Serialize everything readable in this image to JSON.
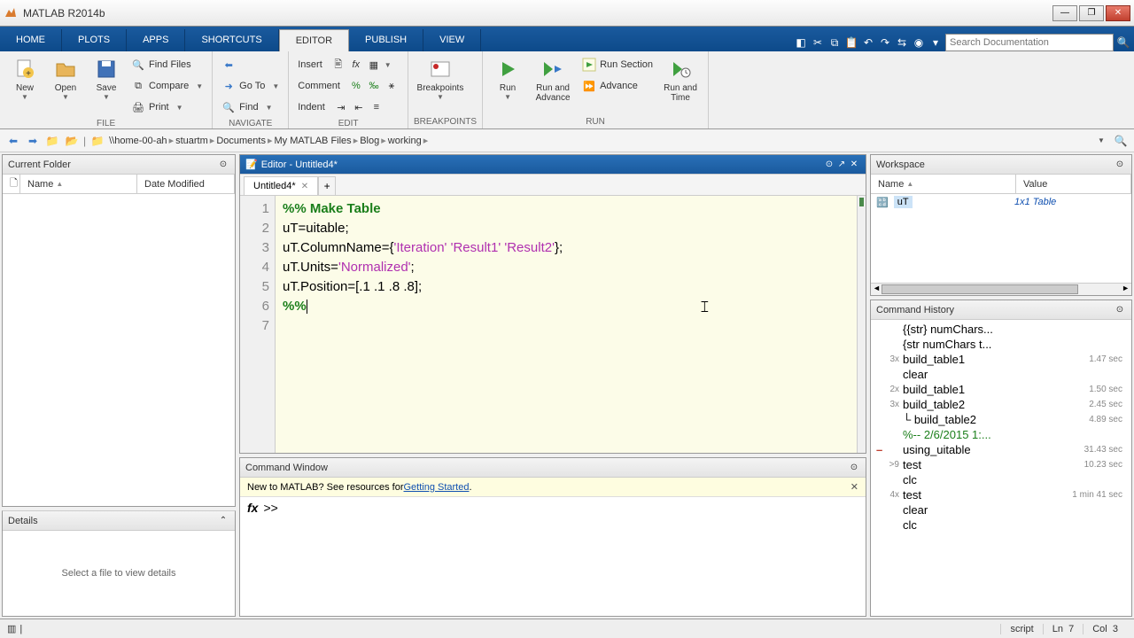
{
  "window": {
    "title": "MATLAB R2014b"
  },
  "tabs": [
    "HOME",
    "PLOTS",
    "APPS",
    "SHORTCUTS",
    "EDITOR",
    "PUBLISH",
    "VIEW"
  ],
  "activeTab": 4,
  "search": {
    "placeholder": "Search Documentation"
  },
  "toolstrip": {
    "file": {
      "new": "New",
      "open": "Open",
      "save": "Save",
      "findFiles": "Find Files",
      "compare": "Compare",
      "print": "Print",
      "label": "FILE"
    },
    "nav": {
      "goto": "Go To",
      "find": "Find",
      "label": "NAVIGATE"
    },
    "edit": {
      "insert": "Insert",
      "comment": "Comment",
      "indent": "Indent",
      "label": "EDIT"
    },
    "bp": {
      "breakpoints": "Breakpoints",
      "label": "BREAKPOINTS"
    },
    "run": {
      "run": "Run",
      "runAdvance": "Run and\nAdvance",
      "runSection": "Run Section",
      "advance": "Advance",
      "runTime": "Run and\nTime",
      "label": "RUN"
    }
  },
  "breadcrumb": [
    "\\\\home-00-ah",
    "stuartm",
    "Documents",
    "My MATLAB Files",
    "Blog",
    "working"
  ],
  "currentFolder": {
    "title": "Current Folder",
    "cols": [
      "Name",
      "Date Modified"
    ]
  },
  "details": {
    "title": "Details",
    "msg": "Select a file to view details"
  },
  "editor": {
    "title": "Editor - Untitled4*",
    "tab": "Untitled4*",
    "lines": [
      {
        "n": 1,
        "seg": [
          {
            "c": "comment",
            "t": "%% Make Table"
          }
        ]
      },
      {
        "n": 2,
        "seg": [
          {
            "c": "",
            "t": "uT=uitable;"
          }
        ]
      },
      {
        "n": 3,
        "seg": [
          {
            "c": "",
            "t": "uT.ColumnName={"
          },
          {
            "c": "string",
            "t": "'Iteration'"
          },
          {
            "c": "",
            "t": " "
          },
          {
            "c": "string",
            "t": "'Result1'"
          },
          {
            "c": "",
            "t": " "
          },
          {
            "c": "string",
            "t": "'Result2'"
          },
          {
            "c": "",
            "t": "};"
          }
        ]
      },
      {
        "n": 4,
        "seg": [
          {
            "c": "",
            "t": "uT.Units="
          },
          {
            "c": "string",
            "t": "'Normalized'"
          },
          {
            "c": "",
            "t": ";"
          }
        ]
      },
      {
        "n": 5,
        "seg": [
          {
            "c": "",
            "t": "uT.Position=[.1 .1 .8 .8];"
          }
        ]
      },
      {
        "n": 6,
        "seg": [
          {
            "c": "",
            "t": ""
          }
        ]
      },
      {
        "n": 7,
        "seg": [
          {
            "c": "comment",
            "t": "%%"
          }
        ]
      }
    ]
  },
  "cmdwin": {
    "title": "Command Window",
    "tip_pre": "New to MATLAB? See resources for ",
    "tip_link": "Getting Started",
    "tip_post": ".",
    "prompt": ">>"
  },
  "workspace": {
    "title": "Workspace",
    "cols": [
      "Name",
      "Value"
    ],
    "rows": [
      {
        "name": "uT",
        "value": "1x1 Table"
      }
    ]
  },
  "history": {
    "title": "Command History",
    "items": [
      {
        "cnt": "",
        "txt": "{{str} numChars...",
        "time": ""
      },
      {
        "cnt": "",
        "txt": "{str numChars t...",
        "time": ""
      },
      {
        "cnt": "3x",
        "txt": "build_table1",
        "time": "1.47 sec"
      },
      {
        "cnt": "",
        "txt": "clear",
        "time": ""
      },
      {
        "cnt": "2x",
        "txt": "build_table1",
        "time": "1.50 sec"
      },
      {
        "cnt": "3x",
        "txt": "build_table2",
        "time": "2.45 sec"
      },
      {
        "cnt": "",
        "txt": "build_table2",
        "time": "4.89 sec",
        "tree": true
      },
      {
        "cnt": "",
        "txt": "%-- 2/6/2015 1:...",
        "time": "",
        "green": true
      },
      {
        "cnt": "",
        "txt": "using_uitable",
        "time": "31.43 sec",
        "mark": true
      },
      {
        "cnt": ">9",
        "txt": "test",
        "time": "10.23 sec"
      },
      {
        "cnt": "",
        "txt": "clc",
        "time": ""
      },
      {
        "cnt": "4x",
        "txt": "test",
        "time": "1 min 41 sec"
      },
      {
        "cnt": "",
        "txt": "clear",
        "time": ""
      },
      {
        "cnt": "",
        "txt": "clc",
        "time": ""
      }
    ]
  },
  "status": {
    "type": "script",
    "ln": "Ln",
    "lnv": "7",
    "col": "Col",
    "colv": "3"
  }
}
